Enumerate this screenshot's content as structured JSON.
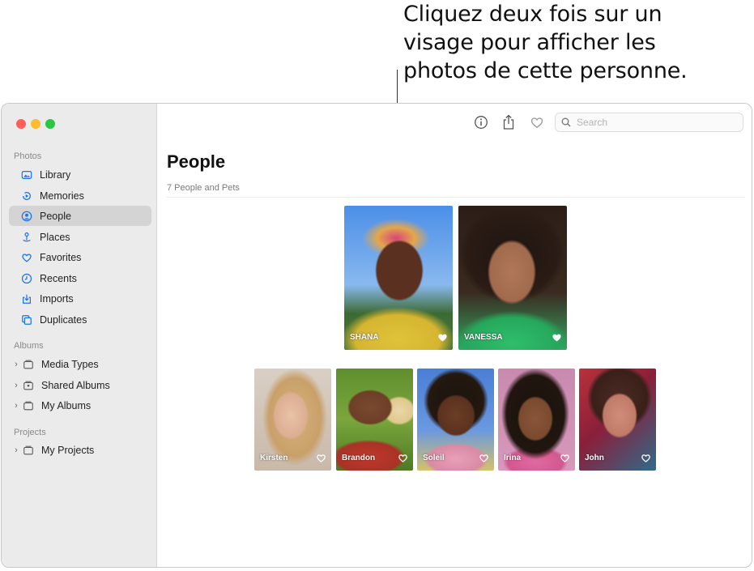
{
  "callout": {
    "line1": "Cliquez deux fois sur un",
    "line2": "visage pour afficher les",
    "line3": "photos de cette personne."
  },
  "sidebar": {
    "photos_title": "Photos",
    "items": [
      {
        "label": "Library",
        "icon": "library-icon"
      },
      {
        "label": "Memories",
        "icon": "memories-icon"
      },
      {
        "label": "People",
        "icon": "people-icon",
        "selected": true
      },
      {
        "label": "Places",
        "icon": "places-icon"
      },
      {
        "label": "Favorites",
        "icon": "heart-icon"
      },
      {
        "label": "Recents",
        "icon": "clock-icon"
      },
      {
        "label": "Imports",
        "icon": "import-icon"
      },
      {
        "label": "Duplicates",
        "icon": "duplicates-icon"
      }
    ],
    "albums_title": "Albums",
    "albums": [
      {
        "label": "Media Types"
      },
      {
        "label": "Shared Albums"
      },
      {
        "label": "My Albums"
      }
    ],
    "projects_title": "Projects",
    "projects": [
      {
        "label": "My Projects"
      }
    ]
  },
  "toolbar": {
    "search_placeholder": "Search"
  },
  "main": {
    "title": "People",
    "subtitle": "7 People and Pets"
  },
  "favorites": [
    {
      "name": "SHANA",
      "favorited": true
    },
    {
      "name": "VANESSA",
      "favorited": true
    }
  ],
  "people": [
    {
      "name": "Kirsten",
      "favorited": false
    },
    {
      "name": "Brandon",
      "favorited": false
    },
    {
      "name": "Soleil",
      "favorited": false
    },
    {
      "name": "Irina",
      "favorited": false
    },
    {
      "name": "John",
      "favorited": false
    }
  ],
  "colors": {
    "accent": "#1a73e8",
    "sidebar_bg": "#ebebeb",
    "selected_bg": "#d4d4d4"
  }
}
